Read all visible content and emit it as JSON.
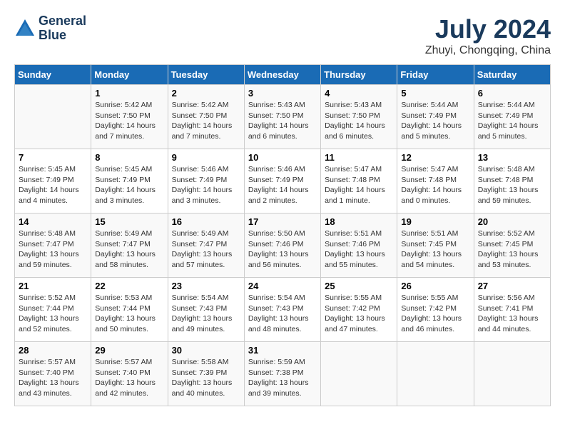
{
  "header": {
    "logo_line1": "General",
    "logo_line2": "Blue",
    "title": "July 2024",
    "subtitle": "Zhuyi, Chongqing, China"
  },
  "days_of_week": [
    "Sunday",
    "Monday",
    "Tuesday",
    "Wednesday",
    "Thursday",
    "Friday",
    "Saturday"
  ],
  "weeks": [
    [
      {
        "day": "",
        "info": ""
      },
      {
        "day": "1",
        "info": "Sunrise: 5:42 AM\nSunset: 7:50 PM\nDaylight: 14 hours\nand 7 minutes."
      },
      {
        "day": "2",
        "info": "Sunrise: 5:42 AM\nSunset: 7:50 PM\nDaylight: 14 hours\nand 7 minutes."
      },
      {
        "day": "3",
        "info": "Sunrise: 5:43 AM\nSunset: 7:50 PM\nDaylight: 14 hours\nand 6 minutes."
      },
      {
        "day": "4",
        "info": "Sunrise: 5:43 AM\nSunset: 7:50 PM\nDaylight: 14 hours\nand 6 minutes."
      },
      {
        "day": "5",
        "info": "Sunrise: 5:44 AM\nSunset: 7:49 PM\nDaylight: 14 hours\nand 5 minutes."
      },
      {
        "day": "6",
        "info": "Sunrise: 5:44 AM\nSunset: 7:49 PM\nDaylight: 14 hours\nand 5 minutes."
      }
    ],
    [
      {
        "day": "7",
        "info": "Sunrise: 5:45 AM\nSunset: 7:49 PM\nDaylight: 14 hours\nand 4 minutes."
      },
      {
        "day": "8",
        "info": "Sunrise: 5:45 AM\nSunset: 7:49 PM\nDaylight: 14 hours\nand 3 minutes."
      },
      {
        "day": "9",
        "info": "Sunrise: 5:46 AM\nSunset: 7:49 PM\nDaylight: 14 hours\nand 3 minutes."
      },
      {
        "day": "10",
        "info": "Sunrise: 5:46 AM\nSunset: 7:49 PM\nDaylight: 14 hours\nand 2 minutes."
      },
      {
        "day": "11",
        "info": "Sunrise: 5:47 AM\nSunset: 7:48 PM\nDaylight: 14 hours\nand 1 minute."
      },
      {
        "day": "12",
        "info": "Sunrise: 5:47 AM\nSunset: 7:48 PM\nDaylight: 14 hours\nand 0 minutes."
      },
      {
        "day": "13",
        "info": "Sunrise: 5:48 AM\nSunset: 7:48 PM\nDaylight: 13 hours\nand 59 minutes."
      }
    ],
    [
      {
        "day": "14",
        "info": "Sunrise: 5:48 AM\nSunset: 7:47 PM\nDaylight: 13 hours\nand 59 minutes."
      },
      {
        "day": "15",
        "info": "Sunrise: 5:49 AM\nSunset: 7:47 PM\nDaylight: 13 hours\nand 58 minutes."
      },
      {
        "day": "16",
        "info": "Sunrise: 5:49 AM\nSunset: 7:47 PM\nDaylight: 13 hours\nand 57 minutes."
      },
      {
        "day": "17",
        "info": "Sunrise: 5:50 AM\nSunset: 7:46 PM\nDaylight: 13 hours\nand 56 minutes."
      },
      {
        "day": "18",
        "info": "Sunrise: 5:51 AM\nSunset: 7:46 PM\nDaylight: 13 hours\nand 55 minutes."
      },
      {
        "day": "19",
        "info": "Sunrise: 5:51 AM\nSunset: 7:45 PM\nDaylight: 13 hours\nand 54 minutes."
      },
      {
        "day": "20",
        "info": "Sunrise: 5:52 AM\nSunset: 7:45 PM\nDaylight: 13 hours\nand 53 minutes."
      }
    ],
    [
      {
        "day": "21",
        "info": "Sunrise: 5:52 AM\nSunset: 7:44 PM\nDaylight: 13 hours\nand 52 minutes."
      },
      {
        "day": "22",
        "info": "Sunrise: 5:53 AM\nSunset: 7:44 PM\nDaylight: 13 hours\nand 50 minutes."
      },
      {
        "day": "23",
        "info": "Sunrise: 5:54 AM\nSunset: 7:43 PM\nDaylight: 13 hours\nand 49 minutes."
      },
      {
        "day": "24",
        "info": "Sunrise: 5:54 AM\nSunset: 7:43 PM\nDaylight: 13 hours\nand 48 minutes."
      },
      {
        "day": "25",
        "info": "Sunrise: 5:55 AM\nSunset: 7:42 PM\nDaylight: 13 hours\nand 47 minutes."
      },
      {
        "day": "26",
        "info": "Sunrise: 5:55 AM\nSunset: 7:42 PM\nDaylight: 13 hours\nand 46 minutes."
      },
      {
        "day": "27",
        "info": "Sunrise: 5:56 AM\nSunset: 7:41 PM\nDaylight: 13 hours\nand 44 minutes."
      }
    ],
    [
      {
        "day": "28",
        "info": "Sunrise: 5:57 AM\nSunset: 7:40 PM\nDaylight: 13 hours\nand 43 minutes."
      },
      {
        "day": "29",
        "info": "Sunrise: 5:57 AM\nSunset: 7:40 PM\nDaylight: 13 hours\nand 42 minutes."
      },
      {
        "day": "30",
        "info": "Sunrise: 5:58 AM\nSunset: 7:39 PM\nDaylight: 13 hours\nand 40 minutes."
      },
      {
        "day": "31",
        "info": "Sunrise: 5:59 AM\nSunset: 7:38 PM\nDaylight: 13 hours\nand 39 minutes."
      },
      {
        "day": "",
        "info": ""
      },
      {
        "day": "",
        "info": ""
      },
      {
        "day": "",
        "info": ""
      }
    ]
  ]
}
